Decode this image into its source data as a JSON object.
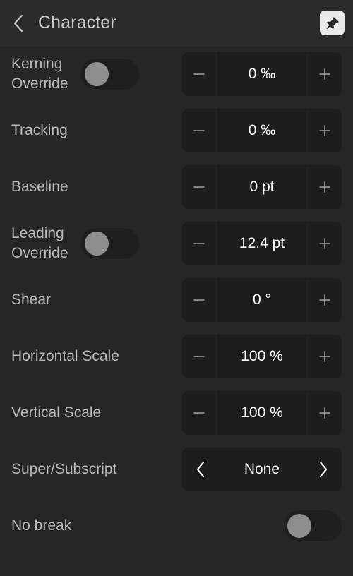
{
  "header": {
    "title": "Character",
    "back_icon": "chevron-left-icon",
    "pin_icon": "pin-icon",
    "pin_active": true
  },
  "colors": {
    "panel_bg": "#262626",
    "header_bg": "#2b2b2b",
    "control_bg": "#1d1d1d",
    "toggle_track": "#1f1f1f",
    "toggle_knob": "#8e8e8e",
    "label_text": "#b9b9b9",
    "value_text": "#ffffff",
    "pin_bg": "#e9e9e9"
  },
  "icons": {
    "minus": "minus-icon",
    "plus": "plus-icon",
    "chevron_left": "chevron-left-icon",
    "chevron_right": "chevron-right-icon"
  },
  "rows": [
    {
      "key": "kerning_override",
      "label": "Kerning Override",
      "label_line1": "Kerning",
      "label_line2": "Override",
      "control": "stepper",
      "has_toggle": true,
      "toggle_on": false,
      "value": "0 ‰",
      "decrement_label": "−",
      "increment_label": "+"
    },
    {
      "key": "tracking",
      "label": "Tracking",
      "control": "stepper",
      "has_toggle": false,
      "value": "0 ‰",
      "decrement_label": "−",
      "increment_label": "+"
    },
    {
      "key": "baseline",
      "label": "Baseline",
      "control": "stepper",
      "has_toggle": false,
      "value": "0 pt",
      "decrement_label": "−",
      "increment_label": "+"
    },
    {
      "key": "leading_override",
      "label": "Leading Override",
      "label_line1": "Leading",
      "label_line2": "Override",
      "control": "stepper",
      "has_toggle": true,
      "toggle_on": false,
      "value": "12.4 pt",
      "decrement_label": "−",
      "increment_label": "+"
    },
    {
      "key": "shear",
      "label": "Shear",
      "control": "stepper",
      "has_toggle": false,
      "value": "0 °",
      "decrement_label": "−",
      "increment_label": "+"
    },
    {
      "key": "horizontal_scale",
      "label": "Horizontal Scale",
      "control": "stepper",
      "has_toggle": false,
      "value": "100 %",
      "decrement_label": "−",
      "increment_label": "+"
    },
    {
      "key": "vertical_scale",
      "label": "Vertical Scale",
      "control": "stepper",
      "has_toggle": false,
      "value": "100 %",
      "decrement_label": "−",
      "increment_label": "+"
    },
    {
      "key": "super_subscript",
      "label": "Super/Subscript",
      "control": "picker",
      "has_toggle": false,
      "value": "None",
      "prev_label": "‹",
      "next_label": "›"
    },
    {
      "key": "no_break",
      "label": "No break",
      "control": "toggle",
      "has_toggle": true,
      "toggle_on": false,
      "value": ""
    }
  ]
}
